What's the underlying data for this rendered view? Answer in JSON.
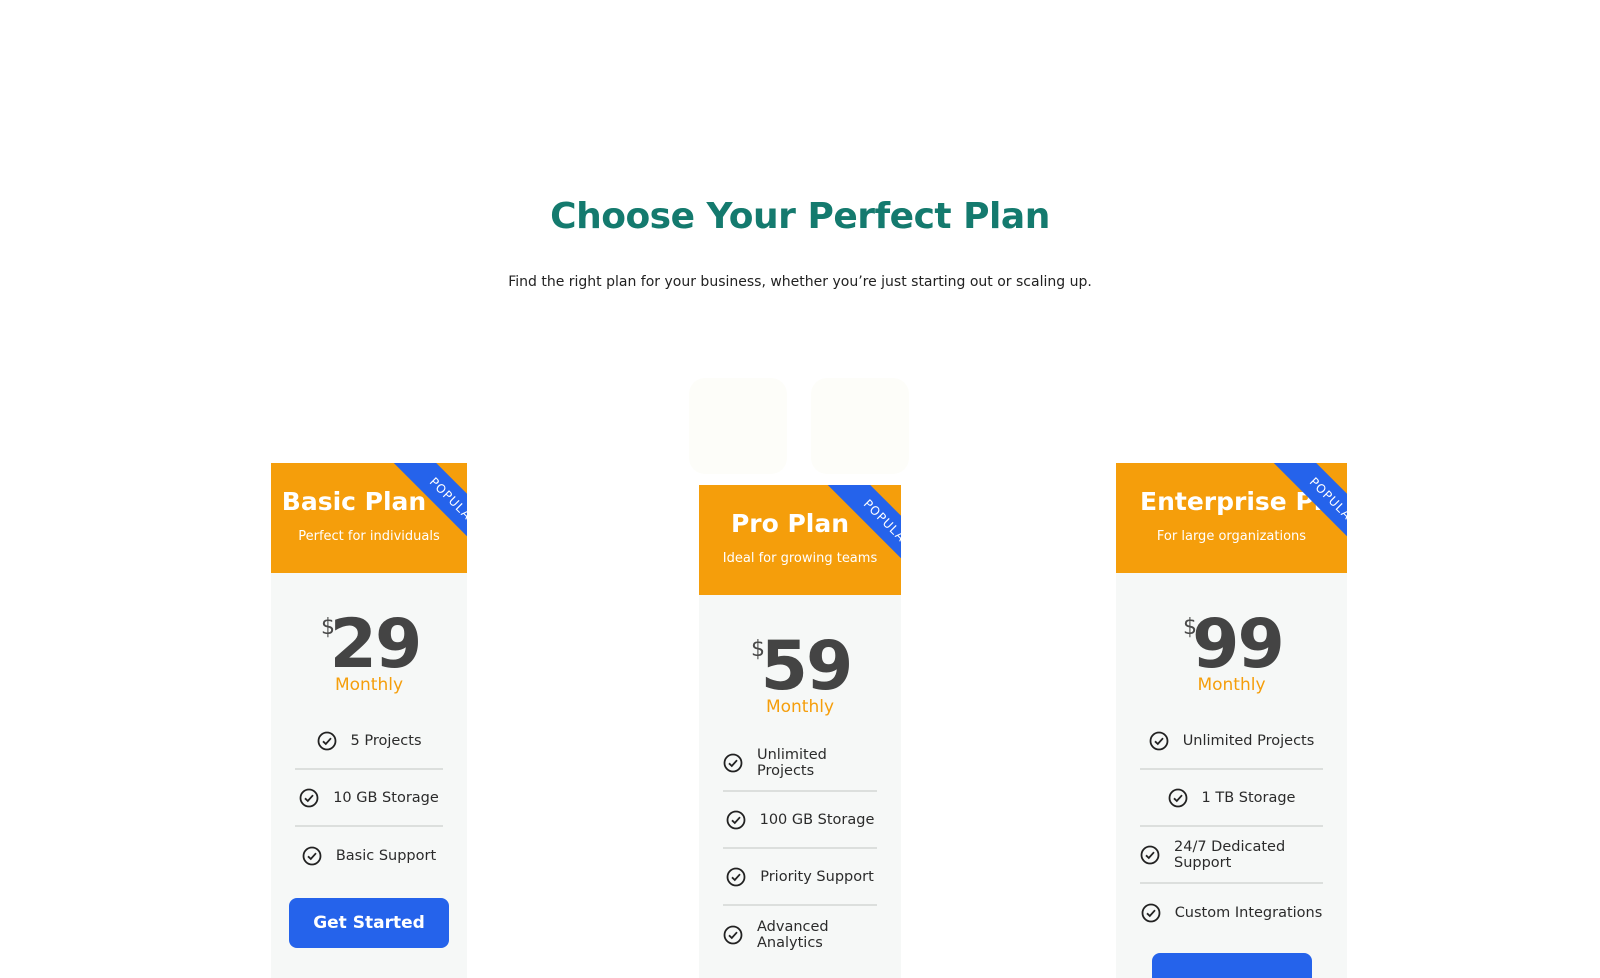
{
  "header": {
    "title": "Choose Your Perfect Plan",
    "subtitle": "Find the right plan for your business, whether you’re just starting out or scaling up."
  },
  "colors": {
    "accent": "#f59e0b",
    "primary": "#2563eb",
    "title": "#147a6e"
  },
  "plans": [
    {
      "name": "Basic Plan",
      "description": "Perfect for individuals",
      "badge": "POPULAR",
      "currency": "$",
      "price": "29",
      "period": "Monthly",
      "features": [
        "5 Projects",
        "10 GB Storage",
        "Basic Support"
      ],
      "cta": "Get Started"
    },
    {
      "name": "Pro Plan",
      "description": "Ideal for growing teams",
      "badge": "POPULAR",
      "currency": "$",
      "price": "59",
      "period": "Monthly",
      "features": [
        "Unlimited Projects",
        "100 GB Storage",
        "Priority Support",
        "Advanced Analytics"
      ]
    },
    {
      "name": "Enterprise Plan",
      "description": "For large organizations",
      "badge": "POPULAR",
      "currency": "$",
      "price": "99",
      "period": "Monthly",
      "features": [
        "Unlimited Projects",
        "1 TB Storage",
        "24/7 Dedicated Support",
        "Custom Integrations"
      ]
    }
  ]
}
